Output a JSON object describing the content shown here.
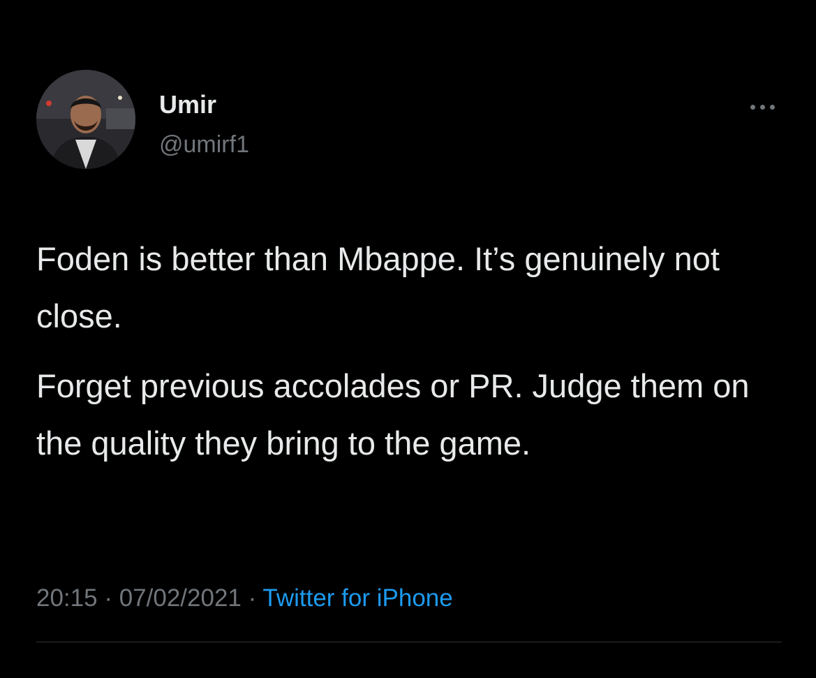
{
  "author": {
    "display_name": "Umir",
    "handle": "@umirf1"
  },
  "tweet": {
    "paragraphs": [
      "Foden is better than Mbappe. It’s genuinely not close.",
      "Forget previous accolades or PR. Judge them on the quality they bring to the game."
    ],
    "time": "20:15",
    "separator": "·",
    "date": "07/02/2021",
    "source": "Twitter for iPhone"
  },
  "icons": {
    "more": "more-horizontal-icon"
  },
  "colors": {
    "background": "#000000",
    "text": "#e7e9ea",
    "secondary_text": "#71767b",
    "link": "#1d9bf0"
  }
}
